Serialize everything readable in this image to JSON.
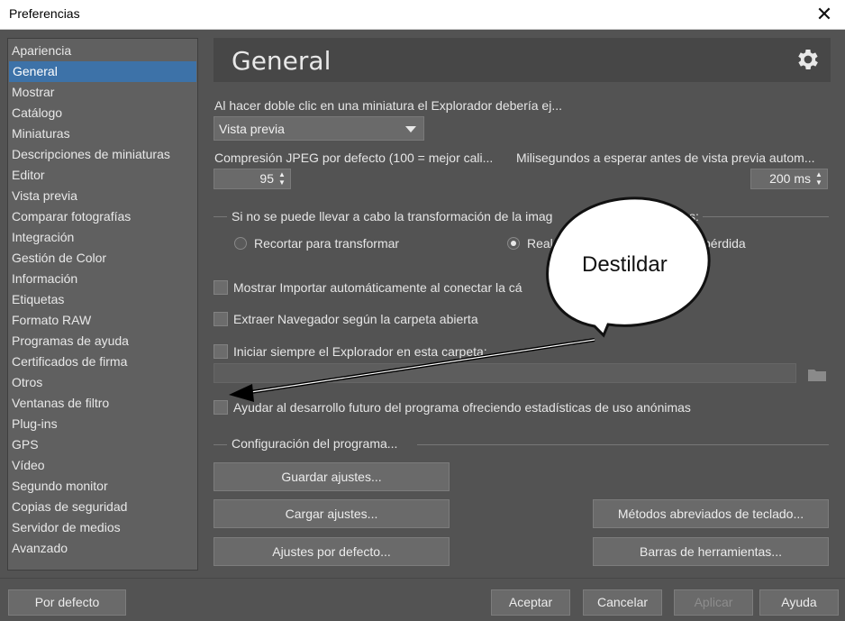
{
  "window": {
    "title": "Preferencias",
    "close_glyph": "✕"
  },
  "sidebar": {
    "items": [
      {
        "label": "Apariencia"
      },
      {
        "label": "General",
        "selected": true
      },
      {
        "label": "Mostrar"
      },
      {
        "label": "Catálogo"
      },
      {
        "label": "Miniaturas"
      },
      {
        "label": "Descripciones de miniaturas"
      },
      {
        "label": "Editor"
      },
      {
        "label": "Vista previa"
      },
      {
        "label": "Comparar fotografías"
      },
      {
        "label": "Integración"
      },
      {
        "label": "Gestión de Color"
      },
      {
        "label": "Información"
      },
      {
        "label": "Etiquetas"
      },
      {
        "label": "Formato RAW"
      },
      {
        "label": "Programas de ayuda"
      },
      {
        "label": "Certificados de firma"
      },
      {
        "label": "Otros"
      },
      {
        "label": "Ventanas de filtro"
      },
      {
        "label": "Plug-ins"
      },
      {
        "label": "GPS"
      },
      {
        "label": "Vídeo"
      },
      {
        "label": "Segundo monitor"
      },
      {
        "label": "Copias de seguridad"
      },
      {
        "label": "Servidor de medios"
      },
      {
        "label": "Avanzado"
      }
    ]
  },
  "header": {
    "title": "General",
    "icon": "gear-icon"
  },
  "double_click": {
    "label": "Al hacer doble clic en una miniatura el Explorador debería ej...",
    "value": "Vista previa"
  },
  "jpeg": {
    "label": "Compresión JPEG por defecto (100 = mejor cali...",
    "value": "95"
  },
  "preview_wait": {
    "label": "Milisegundos a esperar antes de vista previa autom...",
    "value": "200 ms"
  },
  "transform_group": {
    "label": "Si no se puede llevar a cabo la transformación de la imag",
    "label_tail": "s:",
    "option_crop": "Recortar para transformar",
    "option_real": "Real",
    "option_real_tail": "pérdida"
  },
  "checkboxes": {
    "import_auto": "Mostrar Importar automáticamente al conectar la cá",
    "extract_nav": "Extraer Navegador según la carpeta abierta",
    "start_explorer": "Iniciar siempre el Explorador en esta carpeta:",
    "help_dev": "Ayudar al desarrollo futuro del programa ofreciendo estadísticas de uso anónimas"
  },
  "program_config": {
    "label": "Configuración del programa...",
    "save": "Guardar ajustes...",
    "load": "Cargar ajustes...",
    "defaults": "Ajustes por defecto...",
    "shortcuts": "Métodos abreviados de teclado...",
    "toolbars": "Barras de herramientas..."
  },
  "footer": {
    "default": "Por defecto",
    "accept": "Aceptar",
    "cancel": "Cancelar",
    "apply": "Aplicar",
    "help": "Ayuda"
  },
  "annotation": {
    "text": "Destildar"
  },
  "colors": {
    "background": "#535353",
    "panel": "#606060",
    "header": "#474747",
    "selection": "#3d72a8",
    "control": "#6a6a6a"
  }
}
